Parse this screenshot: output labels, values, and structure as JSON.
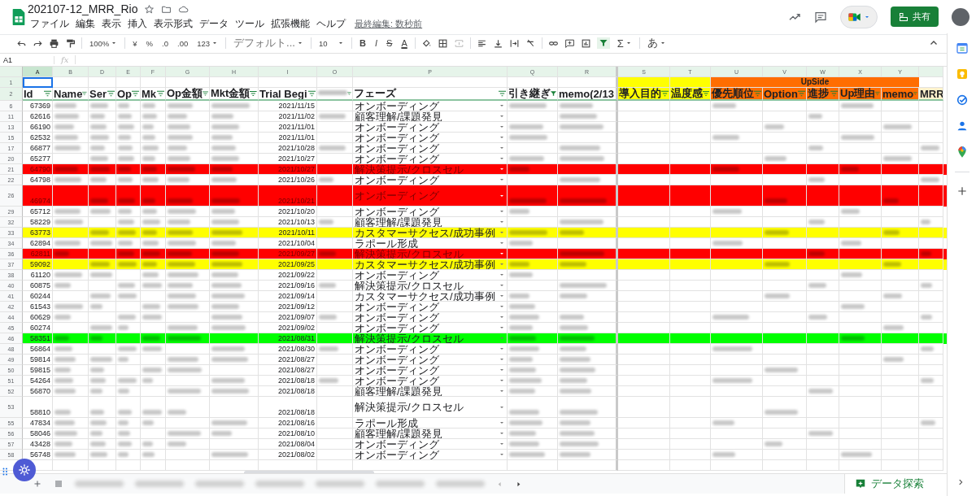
{
  "title": "202107-12_MRR_Rio",
  "menu": [
    "ファイル",
    "編集",
    "表示",
    "挿入",
    "表示形式",
    "データ",
    "ツール",
    "拡張機能",
    "ヘルプ"
  ],
  "last_edit": "最終編集: 数秒前",
  "share_button": "共有",
  "toolbar": {
    "zoom": "100%",
    "currency": "¥",
    "percent": "%",
    "dec_less": ".0",
    "dec_more": ".00",
    "format": "123",
    "font": "デフォルト...",
    "size": "10",
    "bold": "B",
    "italic": "I",
    "strike": "S",
    "text_color": "A",
    "sum": "Σ",
    "input": "あ",
    "filter_on": true
  },
  "name_box": "A1",
  "fx": "fx",
  "columns": [
    {
      "letter": "A",
      "header": "Id",
      "selected": true
    },
    {
      "letter": "B",
      "header": "Name",
      "selected": false
    },
    {
      "letter": "D",
      "header": "Ser",
      "selected": false
    },
    {
      "letter": "E",
      "header": "Op",
      "selected": false
    },
    {
      "letter": "F",
      "header": "Mk",
      "selected": false
    },
    {
      "letter": "G",
      "header": "Op金額",
      "selected": false
    },
    {
      "letter": "H",
      "header": "Mkt金額",
      "selected": false
    },
    {
      "letter": "I",
      "header": "Trial Begi",
      "selected": false
    },
    {
      "letter": "O",
      "selected": false
    },
    {
      "letter": "P",
      "header": "フェーズ",
      "selected": false
    },
    {
      "letter": "Q",
      "header": "引き継ぎ",
      "filter_active": true,
      "selected": false
    },
    {
      "letter": "R",
      "header": "memo(2/13",
      "selected": false
    },
    {
      "letter": "S",
      "header": "導入目的",
      "color": "#ffff00",
      "selected": false
    },
    {
      "letter": "T",
      "header": "温度感",
      "color": "#ffff00",
      "selected": false
    },
    {
      "letter": "U",
      "header": "優先順位",
      "color": "#ff6d01",
      "selected": false
    },
    {
      "letter": "V",
      "header": "Option",
      "color": "#ff6d01",
      "selected": false
    },
    {
      "letter": "W",
      "header": "進捗",
      "color": "#ff6d01",
      "selected": false
    },
    {
      "letter": "X",
      "header": "Up理由",
      "color": "#ff6d01",
      "selected": false
    },
    {
      "letter": "Y",
      "header": "memo",
      "color": "#ff6d01",
      "selected": false
    },
    {
      "header": "MRR",
      "color": "#fff2cc",
      "selected": false
    }
  ],
  "group_header": "UpSide",
  "header_rows": [
    "1",
    "2"
  ],
  "rows": [
    {
      "num": "6",
      "id": "67369",
      "date": "2021/11/15",
      "phase": "オンボーディング"
    },
    {
      "num": "11",
      "id": "62616",
      "date": "2021/11/02",
      "phase": "顧客理解/課題発見"
    },
    {
      "num": "13",
      "id": "66190",
      "date": "2021/11/01",
      "phase": "オンボーディング"
    },
    {
      "num": "15",
      "id": "62532",
      "date": "2021/11/01",
      "phase": "オンボーディング"
    },
    {
      "num": "17",
      "id": "66877",
      "date": "2021/10/28",
      "phase": "オンボーディング"
    },
    {
      "num": "20",
      "id": "65277",
      "date": "2021/10/27",
      "phase": "オンボーディング"
    },
    {
      "num": "21",
      "id": "64790",
      "date": "2021/10/27",
      "phase": "解決策提示/クロスセル",
      "color": "#ff0000"
    },
    {
      "num": "22",
      "id": "64798",
      "date": "2021/10/26",
      "phase": "オンボーディング"
    },
    {
      "num": "26",
      "id": "46974",
      "date": "2021/10/21",
      "phase": "オンボーディング",
      "color": "#ff0000",
      "tall": true
    },
    {
      "num": "29",
      "id": "65712",
      "date": "2021/10/20",
      "phase": "オンボーディング"
    },
    {
      "num": "32",
      "id": "58229",
      "date": "2021/10/13",
      "phase": "顧客理解/課題発見"
    },
    {
      "num": "33",
      "id": "63773",
      "date": "2021/10/11",
      "phase": "カスタマーサクセス/成功事例",
      "color": "#ffff00"
    },
    {
      "num": "34",
      "id": "62894",
      "date": "2021/10/04",
      "phase": "ラポール形成"
    },
    {
      "num": "36",
      "id": "62811",
      "date": "2021/09/27",
      "phase": "解決策提示/クロスセル",
      "color": "#ff0000"
    },
    {
      "num": "37",
      "id": "59092",
      "date": "2021/09/25",
      "phase": "カスタマーサクセス/成功事例",
      "color": "#ffff00"
    },
    {
      "num": "38",
      "id": "61120",
      "date": "2021/09/22",
      "phase": "オンボーディング"
    },
    {
      "num": "40",
      "id": "60875",
      "date": "2021/09/16",
      "phase": "解決策提示/クロスセル"
    },
    {
      "num": "41",
      "id": "60244",
      "date": "2021/09/14",
      "phase": "カスタマーサクセス/成功事例"
    },
    {
      "num": "42",
      "id": "61543",
      "date": "2021/09/12",
      "phase": "オンボーディング"
    },
    {
      "num": "44",
      "id": "60629",
      "date": "2021/09/07",
      "phase": "オンボーディング"
    },
    {
      "num": "45",
      "id": "60274",
      "date": "2021/09/02",
      "phase": "オンボーディング"
    },
    {
      "num": "46",
      "id": "58351",
      "date": "2021/08/31",
      "phase": "解決策提示/クロスセル",
      "color": "#00ff00"
    },
    {
      "num": "48",
      "id": "56864",
      "date": "2021/08/30",
      "phase": "オンボーディング"
    },
    {
      "num": "49",
      "id": "59814",
      "date": "2021/08/27",
      "phase": "オンボーディング"
    },
    {
      "num": "50",
      "id": "59815",
      "date": "2021/08/27",
      "phase": "オンボーディング"
    },
    {
      "num": "51",
      "id": "54264",
      "date": "2021/08/18",
      "phase": "オンボーディング"
    },
    {
      "num": "52",
      "id": "56870",
      "date": "2021/08/18",
      "phase": "顧客理解/課題発見"
    },
    {
      "num": "53",
      "id": "58810",
      "date": "2021/08/18",
      "phase": "解決策提示/クロスセル",
      "tall": true
    },
    {
      "num": "55",
      "id": "47834",
      "date": "2021/08/16",
      "phase": "ラポール形成"
    },
    {
      "num": "56",
      "id": "58046",
      "date": "2021/08/10",
      "phase": "顧客理解/課題発見"
    },
    {
      "num": "57",
      "id": "43428",
      "date": "2021/08/04",
      "phase": "オンボーディング"
    },
    {
      "num": "58",
      "id": "56748",
      "date": "2021/08/02",
      "phase": "オンボーディング"
    }
  ],
  "explore_button": "データ探索"
}
